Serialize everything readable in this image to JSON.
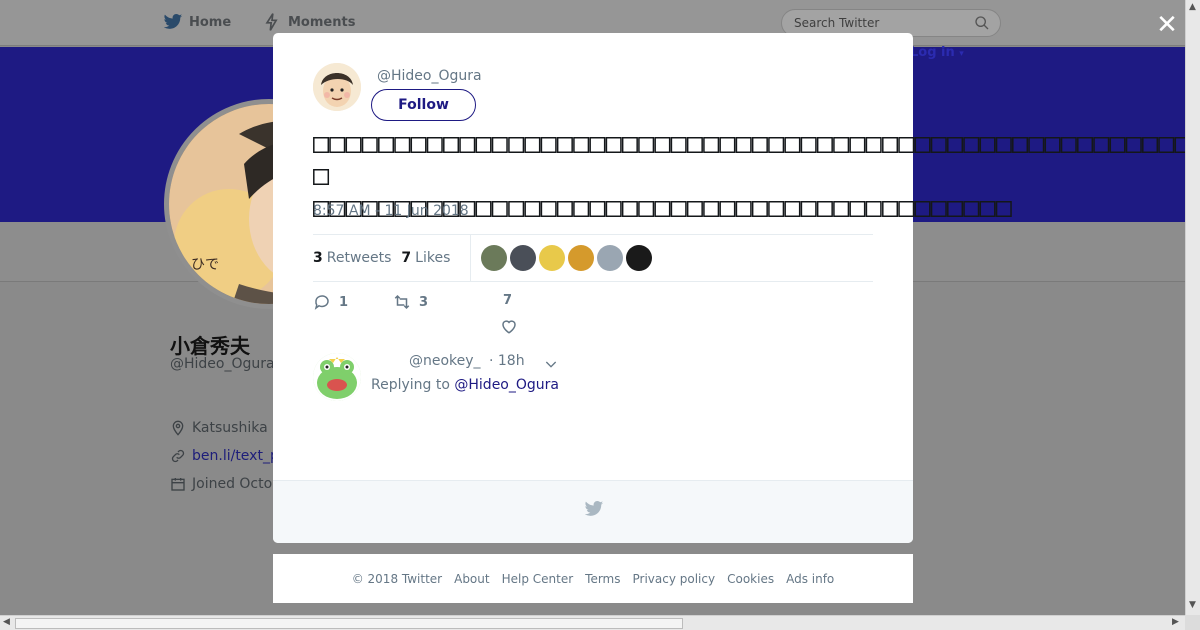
{
  "nav": {
    "home_label": "Home",
    "moments_label": "Moments",
    "search_placeholder": "Search Twitter",
    "login_label": "Log in"
  },
  "profile": {
    "name": "小倉秀夫",
    "handle": "@Hideo_Ogura",
    "location": "Katsushika",
    "link": "ben.li/text_p",
    "joined": "Joined Octo"
  },
  "modal": {
    "close_symbol": "✕",
    "author_handle": "@Hideo_Ogura",
    "follow_label": "Follow",
    "tweet_text": "□□□□□□□□□□□□□□□□□□□□□□□□□□□□□□□□□□□□□□□□□□□□□□□□□□□□□□□□\n□□□□□□□□□□□□□□□□□□□□□□□□□□□□□□□□□□□□□□□□□□□",
    "timestamp": "8:57 AM - 11 Jun 2018",
    "retweets_count": "3",
    "retweets_label": "Retweets",
    "likes_count": "7",
    "likes_label": "Likes",
    "likers": [
      {
        "name": "liker-1",
        "color": "#6b7a5a"
      },
      {
        "name": "liker-2",
        "color": "#4a4f58"
      },
      {
        "name": "liker-3",
        "color": "#e8c94a"
      },
      {
        "name": "liker-4",
        "color": "#d59a2c"
      },
      {
        "name": "liker-5",
        "color": "#9aa6b2"
      },
      {
        "name": "liker-6",
        "color": "#1a1a1a"
      }
    ],
    "actions": {
      "reply_count": "1",
      "retweet_count": "3",
      "like_count": "7"
    }
  },
  "reply": {
    "handle": "@neokey_",
    "time": "· 18h",
    "replying_to_label": "Replying to",
    "replying_to_handle": "@Hideo_Ogura"
  },
  "footer": {
    "links": [
      "© 2018 Twitter",
      "About",
      "Help Center",
      "Terms",
      "Privacy policy",
      "Cookies",
      "Ads info"
    ]
  },
  "colors": {
    "brand": "#1e1a83",
    "overlay": "#8a8a8a",
    "text_secondary": "#657786"
  }
}
